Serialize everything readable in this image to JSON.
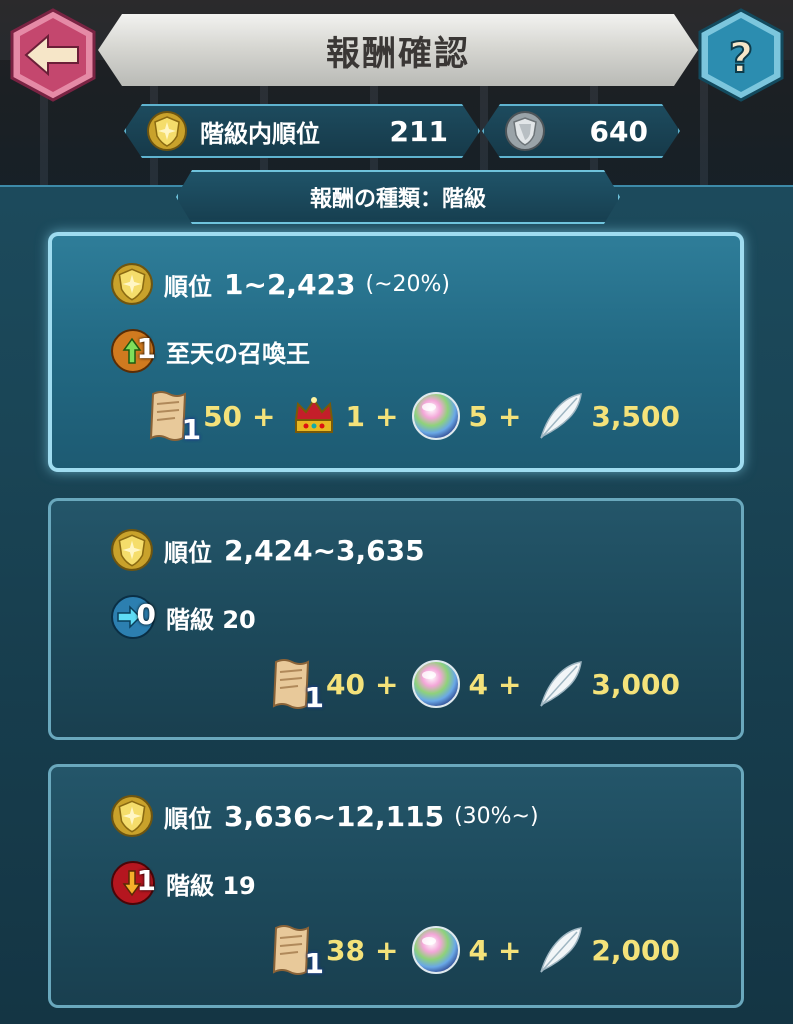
{
  "header": {
    "title": "報酬確認"
  },
  "stats": {
    "rank_label": "階級内順位",
    "rank_value": "211",
    "score_value": "640"
  },
  "reward_type": "報酬の種類：階級",
  "tiers": [
    {
      "rank_label": "順位",
      "rank_range": "1~2,423",
      "rank_pct": "(~20%)",
      "change_num": "1",
      "change_text": "至天の召喚王",
      "change_dir": "up",
      "scroll_num": "1",
      "rewards": {
        "scroll": "50",
        "crown": "1",
        "orb": "5",
        "feather": "3,500"
      },
      "plus": "+"
    },
    {
      "rank_label": "順位",
      "rank_range": "2,424~3,635",
      "rank_pct": "",
      "change_num": "0",
      "change_text": "階級  20",
      "change_dir": "stay",
      "scroll_num": "1",
      "rewards": {
        "scroll": "40",
        "orb": "4",
        "feather": "3,000"
      },
      "plus": "+"
    },
    {
      "rank_label": "順位",
      "rank_range": "3,636~12,115",
      "rank_pct": "(30%~)",
      "change_num": "1",
      "change_text": "階級  19",
      "change_dir": "down",
      "scroll_num": "1",
      "rewards": {
        "scroll": "38",
        "orb": "4",
        "feather": "2,000"
      },
      "plus": "+"
    }
  ],
  "icons": {
    "back": "back-arrow-icon",
    "help": "question-mark-icon",
    "rank": "gold-shield-icon",
    "score": "silver-shield-icon",
    "scroll": "scroll-icon",
    "crown": "crown-icon",
    "orb": "orb-icon",
    "feather": "feather-icon"
  },
  "colors": {
    "accent": "#9fdcf0",
    "reward_text": "#f4e27a",
    "back_button": "#c4476e",
    "help_button": "#2c8db0"
  }
}
